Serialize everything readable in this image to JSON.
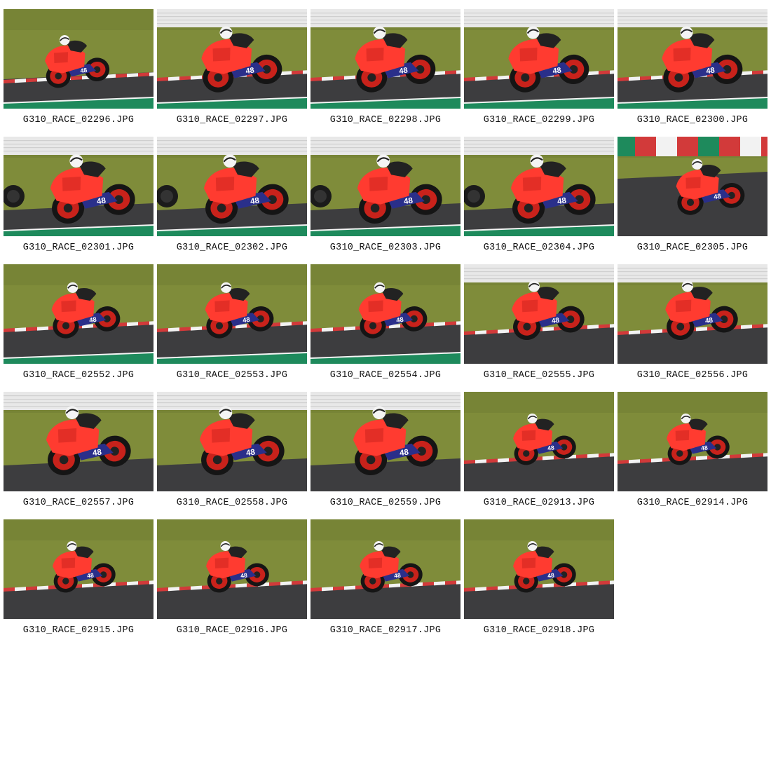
{
  "gallery": {
    "photos": [
      {
        "filename": "G310_RACE_02296.JPG",
        "scene": "kerb-near",
        "rider_number": "48"
      },
      {
        "filename": "G310_RACE_02297.JPG",
        "scene": "barrier-closeup",
        "rider_number": "48"
      },
      {
        "filename": "G310_RACE_02298.JPG",
        "scene": "barrier-closeup",
        "rider_number": "48"
      },
      {
        "filename": "G310_RACE_02299.JPG",
        "scene": "barrier-closeup",
        "rider_number": "48"
      },
      {
        "filename": "G310_RACE_02300.JPG",
        "scene": "barrier-closeup",
        "rider_number": "48"
      },
      {
        "filename": "G310_RACE_02301.JPG",
        "scene": "barrier-pack",
        "rider_number": "48"
      },
      {
        "filename": "G310_RACE_02302.JPG",
        "scene": "barrier-pack",
        "rider_number": "48"
      },
      {
        "filename": "G310_RACE_02303.JPG",
        "scene": "barrier-pack",
        "rider_number": "48"
      },
      {
        "filename": "G310_RACE_02304.JPG",
        "scene": "barrier-pack",
        "rider_number": "48"
      },
      {
        "filename": "G310_RACE_02305.JPG",
        "scene": "redwhite-wall",
        "rider_number": "48"
      },
      {
        "filename": "G310_RACE_02552.JPG",
        "scene": "grass-kerb",
        "rider_number": "48"
      },
      {
        "filename": "G310_RACE_02553.JPG",
        "scene": "grass-kerb",
        "rider_number": "48"
      },
      {
        "filename": "G310_RACE_02554.JPG",
        "scene": "grass-kerb",
        "rider_number": "48"
      },
      {
        "filename": "G310_RACE_02555.JPG",
        "scene": "barrier-kerb",
        "rider_number": "48"
      },
      {
        "filename": "G310_RACE_02556.JPG",
        "scene": "barrier-kerb",
        "rider_number": "48"
      },
      {
        "filename": "G310_RACE_02557.JPG",
        "scene": "barrier-large",
        "rider_number": "48"
      },
      {
        "filename": "G310_RACE_02558.JPG",
        "scene": "barrier-large",
        "rider_number": "48"
      },
      {
        "filename": "G310_RACE_02559.JPG",
        "scene": "barrier-large",
        "rider_number": "48"
      },
      {
        "filename": "G310_RACE_02913.JPG",
        "scene": "kerb-far",
        "rider_number": "48"
      },
      {
        "filename": "G310_RACE_02914.JPG",
        "scene": "kerb-far",
        "rider_number": "48"
      },
      {
        "filename": "G310_RACE_02915.JPG",
        "scene": "kerb-far",
        "rider_number": "48"
      },
      {
        "filename": "G310_RACE_02916.JPG",
        "scene": "kerb-far",
        "rider_number": "48"
      },
      {
        "filename": "G310_RACE_02917.JPG",
        "scene": "kerb-far",
        "rider_number": "48"
      },
      {
        "filename": "G310_RACE_02918.JPG",
        "scene": "kerb-far",
        "rider_number": "48"
      }
    ]
  },
  "colors": {
    "grass": "#7f8c3a",
    "grass_dark": "#6a7630",
    "track": "#3d3d3f",
    "track_light": "#4a4a4d",
    "bike_red": "#ff3b30",
    "bike_red_dark": "#c8221b",
    "bike_blue": "#2a2f8a",
    "kerb_red": "#d23a3a",
    "kerb_white": "#f2f2f2",
    "barrier": "#e8e8e8",
    "green_strip": "#1e8a5c",
    "helmet": "#f4f4f4"
  },
  "icons": {
    "thumbnail": "photo-thumbnail-icon"
  }
}
